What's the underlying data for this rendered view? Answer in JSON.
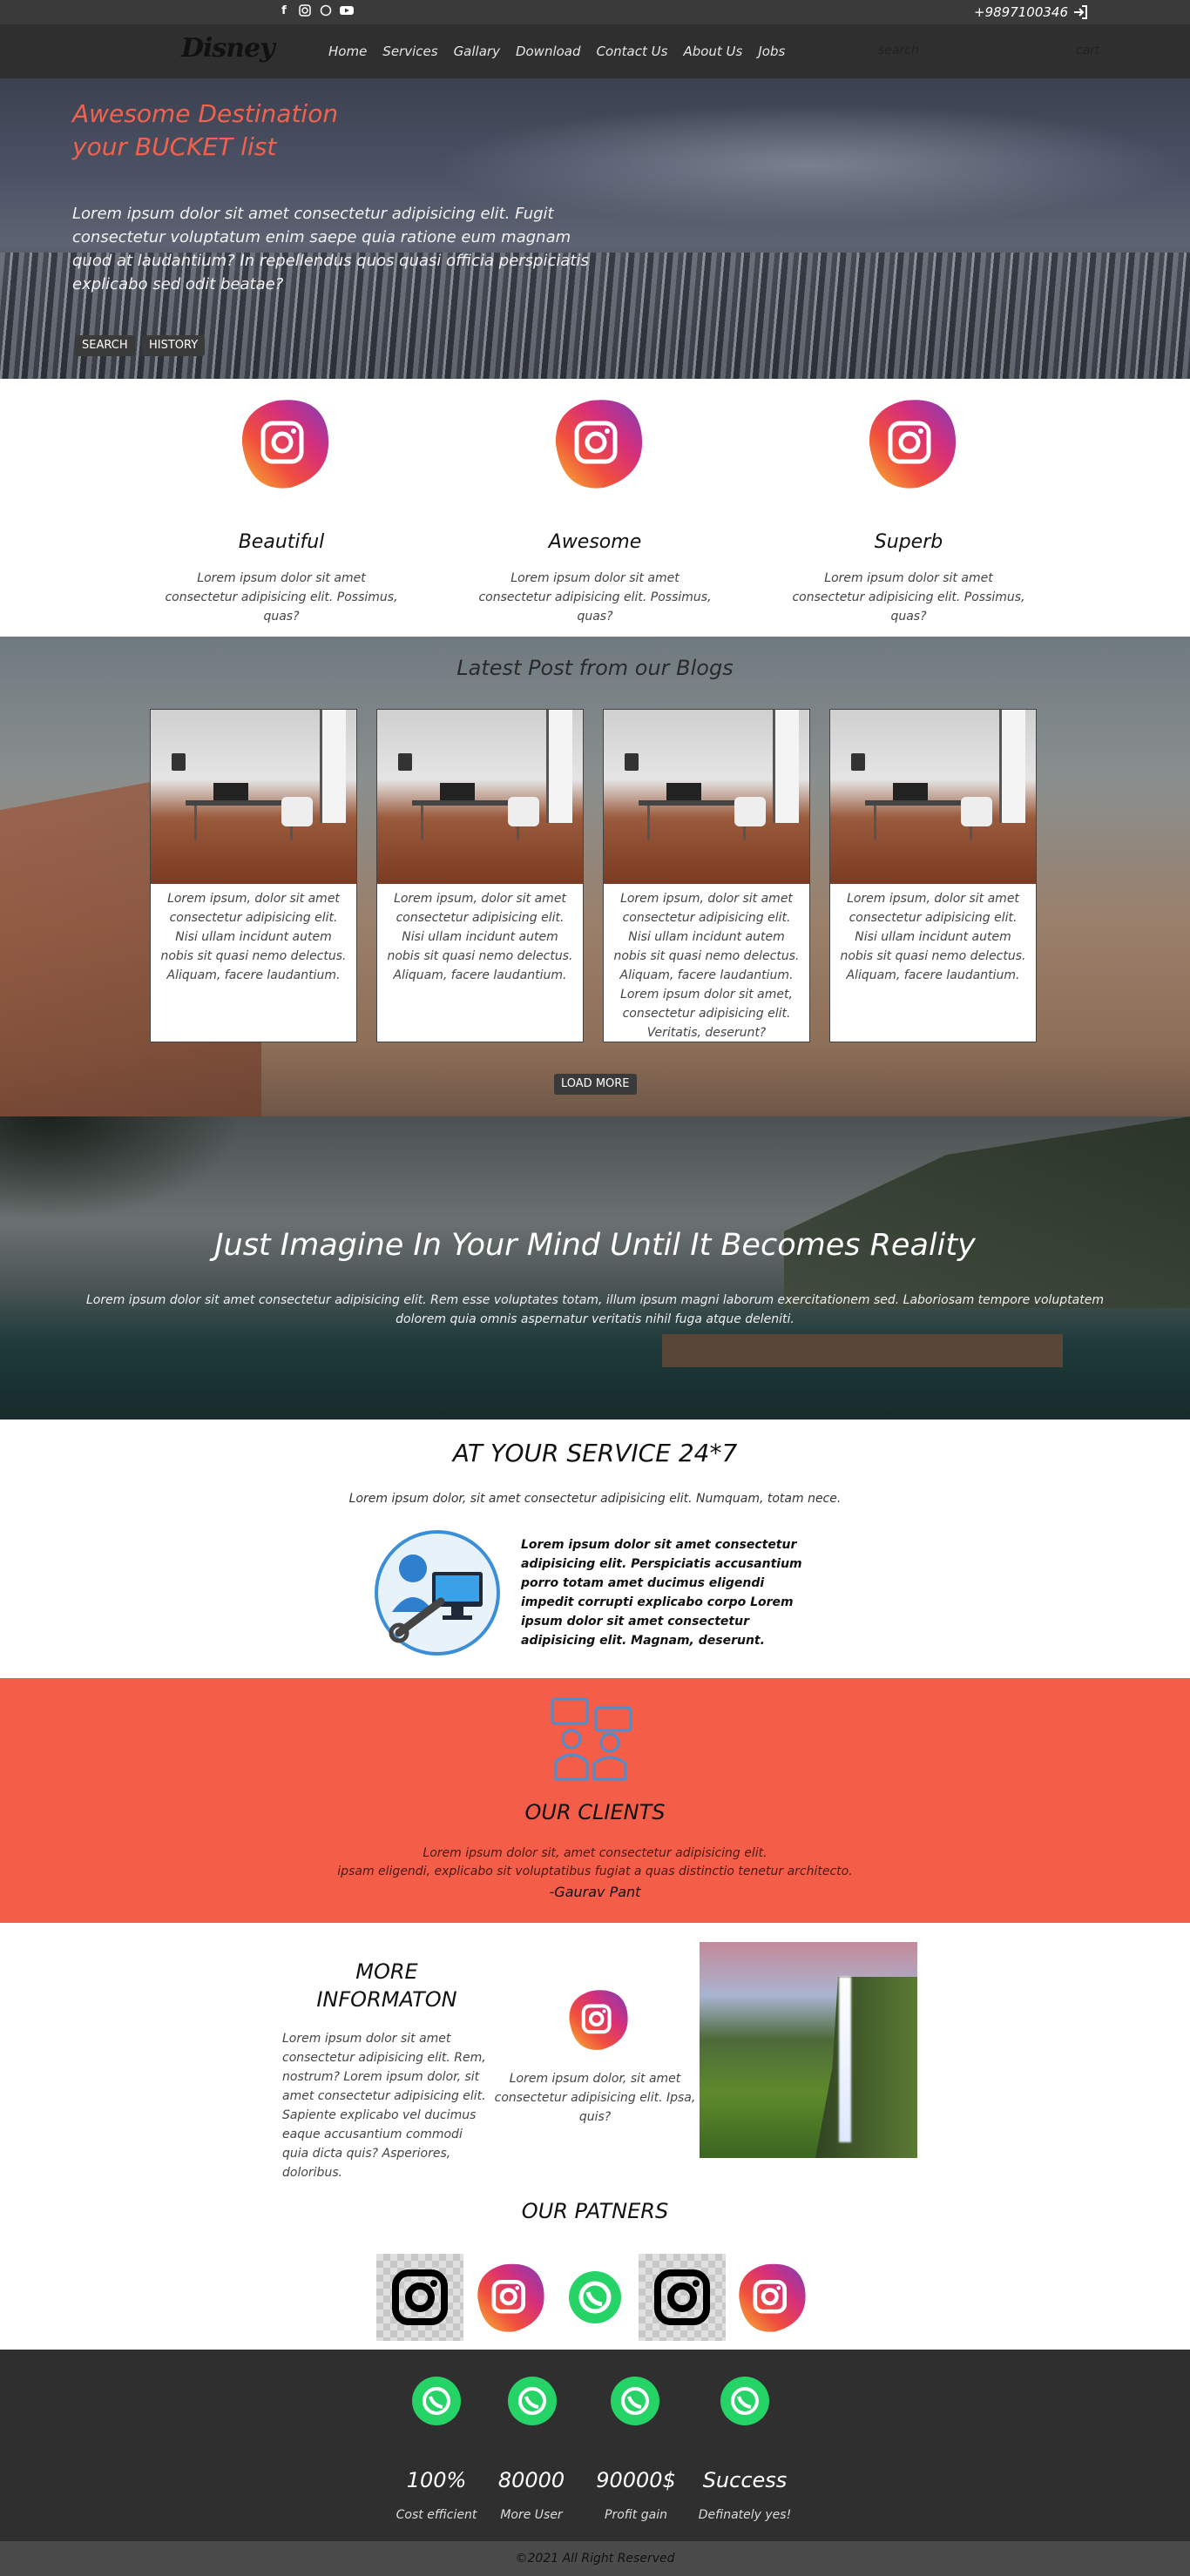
{
  "topbar": {
    "social_icons": [
      "facebook-icon",
      "instagram-icon",
      "whatsapp-icon",
      "youtube-icon"
    ],
    "phone": "+9897100346",
    "login_icon": "sign-in-icon"
  },
  "nav": {
    "logo": "Disney",
    "items": [
      "Home",
      "Services",
      "Gallary",
      "Download",
      "Contact Us",
      "About Us",
      "Jobs"
    ],
    "search_placeholder": "search",
    "cart": "cart"
  },
  "hero": {
    "title_line1": "Awesome Destination",
    "title_line2": "your BUCKET list",
    "text": "Lorem ipsum dolor sit amet consectetur adipisicing elit. Fugit consectetur voluptatum enim saepe quia ratione eum magnam quod at laudantium? In repellendus quos quasi officia perspiciatis explicabo sed odit beatae?",
    "buttons": [
      "SEARCH",
      "HISTORY"
    ]
  },
  "features": [
    {
      "title": "Beautiful",
      "text": "Lorem ipsum dolor sit amet consectetur adipisicing elit. Possimus, quas?"
    },
    {
      "title": "Awesome",
      "text": "Lorem ipsum dolor sit amet consectetur adipisicing elit. Possimus, quas?"
    },
    {
      "title": "Superb",
      "text": "Lorem ipsum dolor sit amet consectetur adipisicing elit. Possimus, quas?"
    }
  ],
  "blog": {
    "title": "Latest Post from our Blogs",
    "cards": [
      {
        "text": "Lorem ipsum, dolor sit amet consectetur adipisicing elit. Nisi ullam incidunt autem nobis sit quasi nemo delectus. Aliquam, facere laudantium."
      },
      {
        "text": "Lorem ipsum, dolor sit amet consectetur adipisicing elit. Nisi ullam incidunt autem nobis sit quasi nemo delectus. Aliquam, facere laudantium."
      },
      {
        "text": "Lorem ipsum, dolor sit amet consectetur adipisicing elit. Nisi ullam incidunt autem nobis sit quasi nemo delectus. Aliquam, facere laudantium. Lorem ipsum dolor sit amet, consectetur adipisicing elit. Veritatis, deserunt?"
      },
      {
        "text": "Lorem ipsum, dolor sit amet consectetur adipisicing elit. Nisi ullam incidunt autem nobis sit quasi nemo delectus. Aliquam, facere laudantium."
      }
    ],
    "load_more": "LOAD MORE"
  },
  "imagine": {
    "title": "Just Imagine In Your Mind Until It Becomes Reality",
    "text": "Lorem ipsum dolor sit amet consectetur adipisicing elit. Rem esse voluptates totam, illum ipsum magni laborum exercitationem sed. Laboriosam tempore voluptatem dolorem quia omnis aspernatur veritatis nihil fuga atque deleniti."
  },
  "service": {
    "title": "AT YOUR SERVICE 24*7",
    "subtitle": "Lorem ipsum dolor, sit amet consectetur adipisicing elit. Numquam, totam nece.",
    "text": "Lorem ipsum dolor sit amet consectetur adipisicing elit. Perspiciatis accusantium porro totam amet ducimus eligendi impedit corrupti explicabo corpo Lorem ipsum dolor sit amet consectetur adipisicing elit. Magnam, deserunt."
  },
  "clients": {
    "title": "OUR CLIENTS",
    "quote_line1": "Lorem ipsum dolor sit, amet consectetur adipisicing elit.",
    "quote_line2": "ipsam eligendi, explicabo sit voluptatibus fugiat a quas distinctio tenetur architecto.",
    "author": "-Gaurav Pant"
  },
  "more": {
    "title": "MORE INFORMATON",
    "text": "Lorem ipsum dolor sit amet consectetur adipisicing elit. Rem, nostrum? Lorem ipsum dolor, sit amet consectetur adipisicing elit. Sapiente explicabo vel ducimus eaque accusantium commodi quia dicta quis? Asperiores, doloribus.",
    "caption": "Lorem ipsum dolor, sit amet consectetur adipisicing elit. Ipsa, quis?"
  },
  "partners": {
    "title": "OUR PATNERS"
  },
  "footer": {
    "stats": [
      {
        "value": "100%",
        "label": "Cost efficient"
      },
      {
        "value": "80000",
        "label": "More User"
      },
      {
        "value": "90000$",
        "label": "Profit gain"
      },
      {
        "value": "Success",
        "label": "Definately yes!"
      }
    ],
    "copyright": "©2021 All Right Reserved"
  },
  "colors": {
    "accent": "#f45d48",
    "dark_bar": "#2f2f2f",
    "whatsapp": "#25d366"
  }
}
